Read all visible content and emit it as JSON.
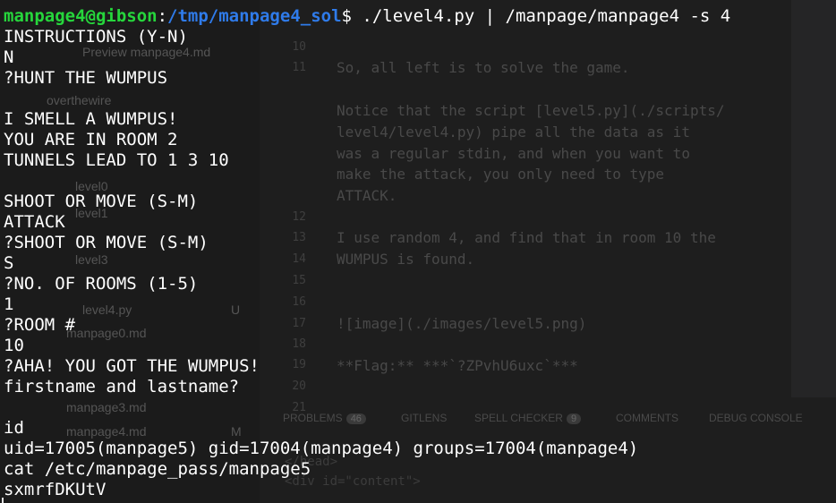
{
  "background_editor": {
    "sidebar_items": [
      "Preview manpage4.md",
      "overthewire",
      "level0",
      "level1",
      "level3",
      "level4.py",
      "manpage0.md",
      "manpage3.md",
      "manpage4.md"
    ],
    "sidebar_badges": [
      "U",
      "M"
    ],
    "line_numbers": [
      "10",
      "11",
      "12",
      "13",
      "14",
      "15",
      "16",
      "17",
      "18",
      "19",
      "20",
      "21"
    ],
    "lines": [
      "So, all left is to solve the game.",
      "Notice that the script [level5.py](./scripts/",
      "level4/level4.py) pipe all the data as it",
      "was a regular stdin, and when you want to",
      "make the attack, you only need to type",
      "ATTACK.",
      "I use random 4, and find that in room 10 the",
      "WUMPUS is found.",
      "![image](./images/level5.png)",
      "**Flag:** ***`?ZPvhU6uxc`***"
    ],
    "panel_tabs": [
      {
        "label": "PROBLEMS",
        "badge": "46"
      },
      {
        "label": "GITLENS",
        "badge": ""
      },
      {
        "label": "SPELL CHECKER",
        "badge": "9"
      },
      {
        "label": "COMMENTS",
        "badge": ""
      },
      {
        "label": "DEBUG CONSOLE",
        "badge": ""
      }
    ],
    "terminal_fragments": [
      "</head>",
      "<div id=\"content\">"
    ]
  },
  "terminal": {
    "prompt": {
      "user_host": "manpage4@gibson",
      "separator": ":",
      "path": "/tmp/manpage4_sol",
      "symbol": "$",
      "command": " ./level4.py | /manpage/manpage4 -s 4"
    },
    "lines": [
      "INSTRUCTIONS (Y-N)",
      "N",
      "?HUNT THE WUMPUS",
      "",
      "I SMELL A WUMPUS!",
      "YOU ARE IN ROOM 2",
      "TUNNELS LEAD TO 1 3 10",
      "",
      "SHOOT OR MOVE (S-M)",
      "ATTACK",
      "?SHOOT OR MOVE (S-M)",
      "S",
      "?NO. OF ROOMS (1-5)",
      "1",
      "?ROOM #",
      "10",
      "?AHA! YOU GOT THE WUMPUS!",
      "firstname and lastname?",
      "",
      "id",
      "uid=17005(manpage5) gid=17004(manpage4) groups=17004(manpage4)",
      "cat /etc/manpage_pass/manpage5",
      "sxmrfDKUtV"
    ]
  }
}
